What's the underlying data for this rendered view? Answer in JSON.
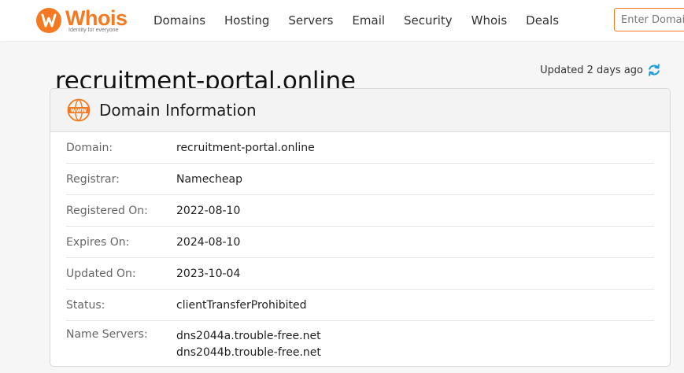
{
  "header": {
    "logo": {
      "brand": "Whois",
      "tagline": "Identity for everyone"
    },
    "nav": [
      "Domains",
      "Hosting",
      "Servers",
      "Email",
      "Security",
      "Whois",
      "Deals"
    ],
    "search_placeholder": "Enter Domain or IP"
  },
  "page": {
    "domain": "recruitment-portal.online",
    "updated_text": "Updated 2 days ago"
  },
  "card": {
    "title": "Domain Information",
    "rows": [
      {
        "label": "Domain:",
        "value": "recruitment-portal.online"
      },
      {
        "label": "Registrar:",
        "value": "Namecheap"
      },
      {
        "label": "Registered On:",
        "value": "2022-08-10"
      },
      {
        "label": "Expires On:",
        "value": "2024-08-10"
      },
      {
        "label": "Updated On:",
        "value": "2023-10-04"
      },
      {
        "label": "Status:",
        "value": "clientTransferProhibited"
      }
    ],
    "name_servers": {
      "label": "Name Servers:",
      "values": [
        "dns2044a.trouble-free.net",
        "dns2044b.trouble-free.net"
      ]
    }
  },
  "colors": {
    "brand_orange": "#f47920",
    "refresh_blue": "#1e9ad6"
  },
  "icons": {
    "logo": "whois-logo-icon",
    "refresh": "refresh-icon",
    "section": "www-globe-icon"
  }
}
